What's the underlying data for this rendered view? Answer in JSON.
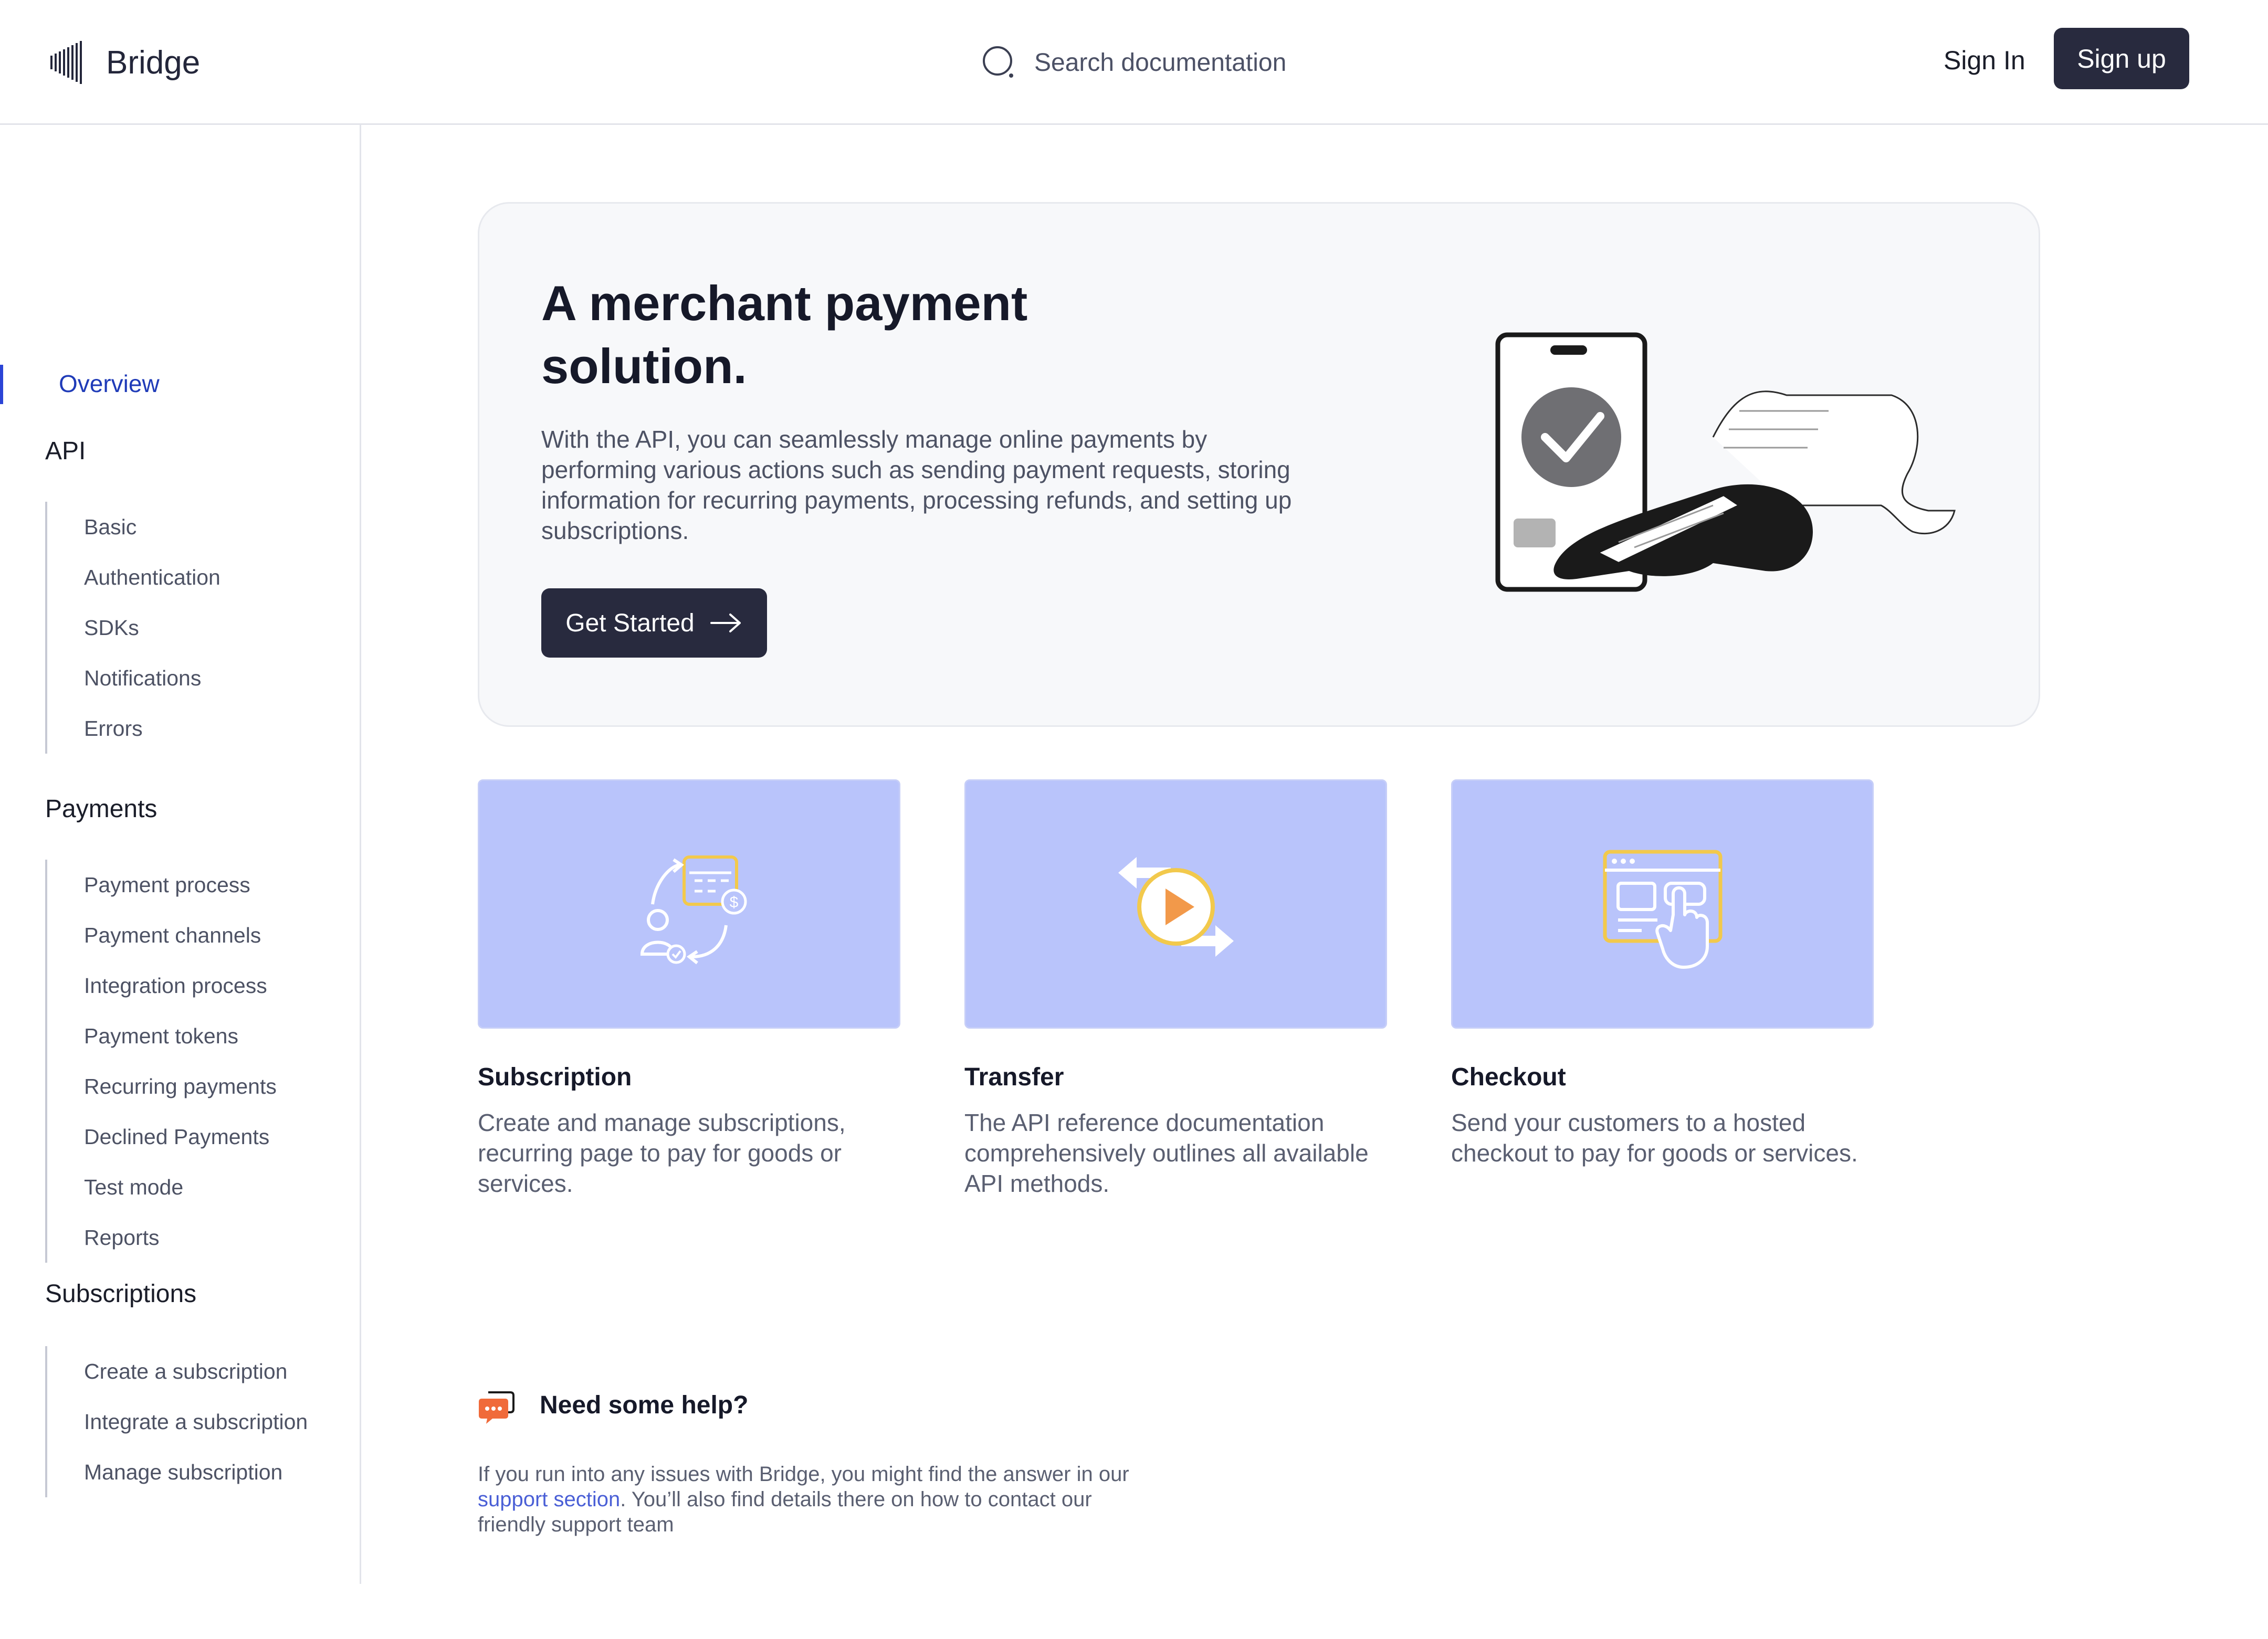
{
  "header": {
    "brand": "Bridge",
    "search_placeholder": "Search documentation",
    "sign_in": "Sign In",
    "sign_up": "Sign up"
  },
  "sidebar": {
    "overview": "Overview",
    "sections": [
      {
        "title": "API",
        "items": [
          "Basic",
          "Authentication",
          "SDKs",
          "Notifications",
          "Errors"
        ]
      },
      {
        "title": "Payments",
        "items": [
          "Payment process",
          "Payment channels",
          "Integration process",
          "Payment tokens",
          "Recurring payments",
          "Declined Payments",
          "Test mode",
          "Reports"
        ]
      },
      {
        "title": "Subscriptions",
        "items": [
          "Create a subscription",
          "Integrate a subscription",
          "Manage subscription"
        ]
      }
    ]
  },
  "hero": {
    "title": "A merchant payment solution.",
    "description": " With the API, you can seamlessly manage online payments by performing various actions such as sending payment requests, storing information for recurring payments, processing refunds, and setting up subscriptions.",
    "cta": "Get Started"
  },
  "cards": [
    {
      "title": "Subscription",
      "description": "Create and manage subscriptions, recurring page to pay for goods or services.",
      "icon": "subscription-cycle-icon"
    },
    {
      "title": "Transfer",
      "description": "The API reference documentation comprehensively outlines all available API methods.",
      "icon": "transfer-arrows-icon"
    },
    {
      "title": "Checkout",
      "description": "Send your customers to a hosted checkout to pay for goods or services.",
      "icon": "checkout-click-icon"
    }
  ],
  "help": {
    "title": "Need some help?",
    "text_before": "If you run into any issues with Bridge, you might find the answer in our ",
    "link": "support section",
    "text_after": ". You’ll also find details there on how to contact our friendly support team"
  },
  "colors": {
    "accent": "#2b44d6",
    "button": "#282a3e",
    "card_bg": "#b9c4fb",
    "link": "#4a5fd6",
    "help_icon": "#f06a3a",
    "icon_yellow": "#f2c94c",
    "icon_orange": "#f2994a"
  }
}
